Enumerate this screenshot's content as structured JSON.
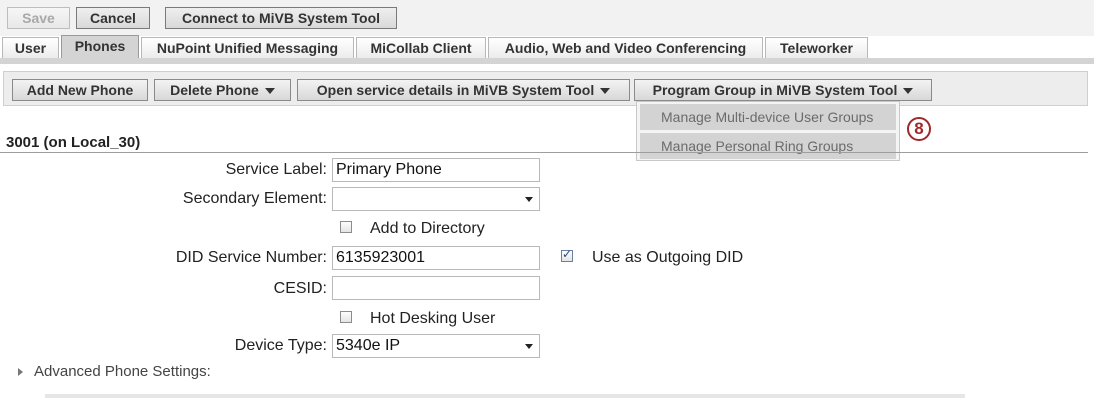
{
  "toolbar": {
    "save_label": "Save",
    "cancel_label": "Cancel",
    "connect_label": "Connect to MiVB System Tool"
  },
  "tabs": [
    {
      "label": "User"
    },
    {
      "label": "Phones"
    },
    {
      "label": "NuPoint Unified Messaging"
    },
    {
      "label": "MiCollab Client"
    },
    {
      "label": "Audio, Web and Video Conferencing"
    },
    {
      "label": "Teleworker"
    }
  ],
  "active_tab": "Phones",
  "actions": {
    "add_phone": "Add New Phone",
    "delete_phone": "Delete Phone",
    "open_service": "Open service details in MiVB System Tool",
    "program_group": "Program Group in MiVB System Tool"
  },
  "menu": {
    "items": [
      {
        "label": "Manage Multi-device User Groups"
      },
      {
        "label": "Manage Personal Ring Groups"
      }
    ]
  },
  "callout": "8",
  "section": {
    "title": "3001 (on Local_30)"
  },
  "form": {
    "service_label": {
      "label": "Service Label:",
      "value": "Primary Phone"
    },
    "secondary_element": {
      "label": "Secondary Element:",
      "value": ""
    },
    "add_to_directory": {
      "label": "Add to Directory",
      "checked": false
    },
    "did_service_number": {
      "label": "DID Service Number:",
      "value": "6135923001"
    },
    "use_outgoing_did": {
      "label": "Use as Outgoing DID",
      "checked": true
    },
    "cesid": {
      "label": "CESID:",
      "value": ""
    },
    "hot_desking": {
      "label": "Hot Desking User",
      "checked": false
    },
    "device_type": {
      "label": "Device Type:",
      "value": "5340e IP"
    }
  },
  "advanced": {
    "label": "Advanced Phone Settings:"
  }
}
